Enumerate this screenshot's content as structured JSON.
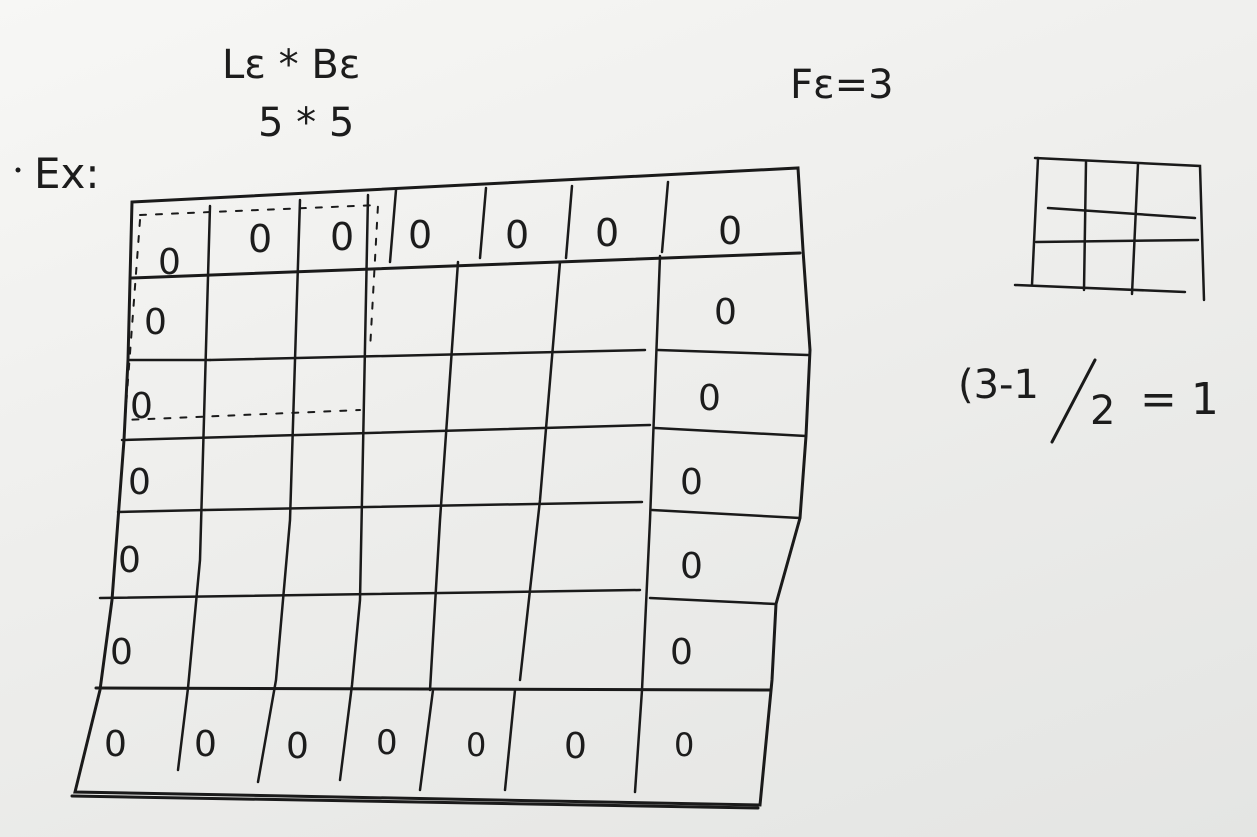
{
  "whiteboard": {
    "formula_line1": "Lε * Bε",
    "formula_line2": "5 * 5",
    "filter_size": "Fε=3",
    "example_label": "Ex:",
    "padding_calc_left": "(3-1",
    "padding_calc_right": "2",
    "padding_calc_result": "= 1",
    "cell_value": "0",
    "padded_grid": {
      "rows": 7,
      "cols": 7,
      "border_value": "0"
    },
    "filter_grid": {
      "rows": 3,
      "cols": 3
    }
  }
}
